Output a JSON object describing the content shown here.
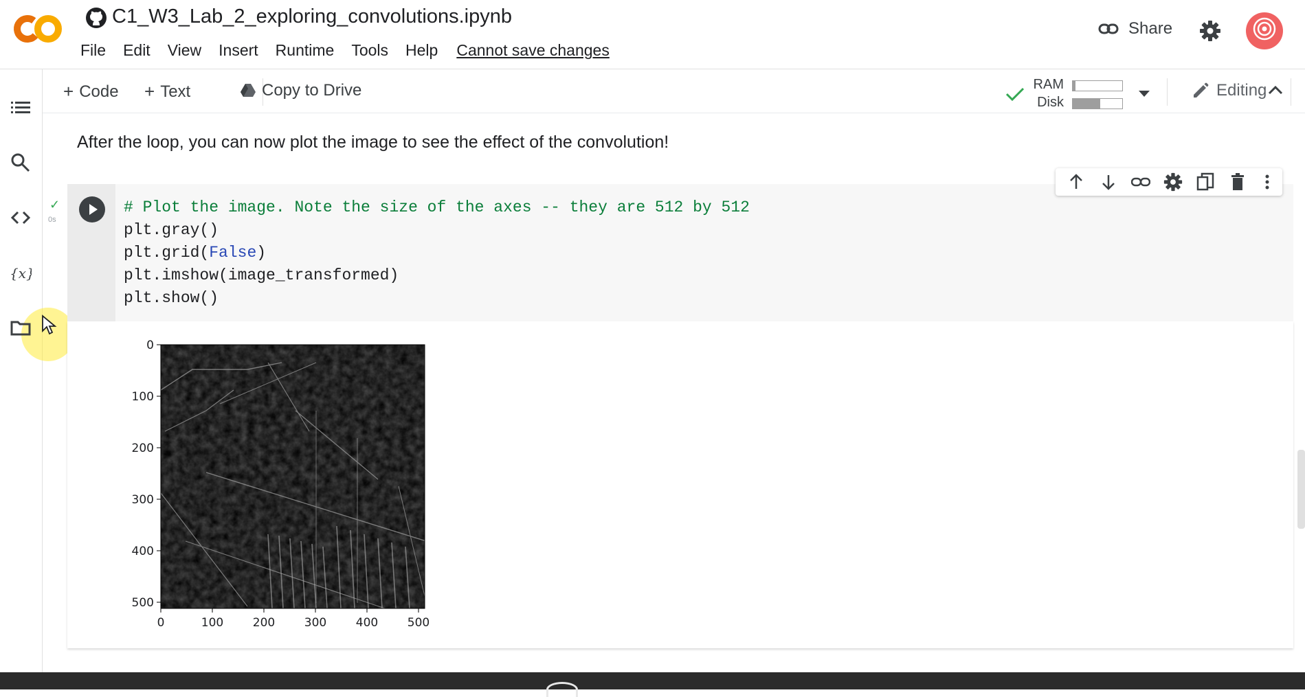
{
  "header": {
    "notebook_title": "C1_W3_Lab_2_exploring_convolutions.ipynb",
    "menu": [
      "File",
      "Edit",
      "View",
      "Insert",
      "Runtime",
      "Tools",
      "Help"
    ],
    "save_status": "Cannot save changes",
    "share_label": "Share",
    "brand_colors": {
      "logo_orange": "#f9ab00",
      "logo_dark_orange": "#e8710a",
      "avatar": "#f06262"
    }
  },
  "toolbar": {
    "add_code": "Code",
    "add_text": "Text",
    "copy_to_drive": "Copy to Drive",
    "ram_label": "RAM",
    "disk_label": "Disk",
    "ram_usage_fraction": 0.05,
    "disk_usage_fraction": 0.55,
    "editing_label": "Editing"
  },
  "sidebar": {
    "icons": [
      "table-of-contents-icon",
      "search-icon",
      "code-snippets-icon",
      "variables-icon",
      "files-icon"
    ]
  },
  "notebook": {
    "text_cell": "After the loop, you can now plot the image to see the effect of the convolution!",
    "code_cell": {
      "exec_time": "0s",
      "lines": [
        "# Plot the image. Note the size of the axes -- they are 512 by 512",
        "plt.gray()",
        "plt.grid(False)",
        "plt.imshow(image_transformed)",
        "plt.show()"
      ]
    },
    "cell_actions": [
      "move-up-icon",
      "move-down-icon",
      "link-icon",
      "gear-icon",
      "mirror-cell-icon",
      "delete-icon",
      "more-icon"
    ]
  },
  "chart_data": {
    "type": "heatmap",
    "title": "",
    "xlabel": "",
    "ylabel": "",
    "xlim": [
      0,
      512
    ],
    "ylim": [
      512,
      0
    ],
    "xticks": [
      "0",
      "100",
      "200",
      "300",
      "400",
      "500"
    ],
    "yticks": [
      "0",
      "100",
      "200",
      "300",
      "400",
      "500"
    ],
    "colormap": "gray",
    "grid": false
  }
}
